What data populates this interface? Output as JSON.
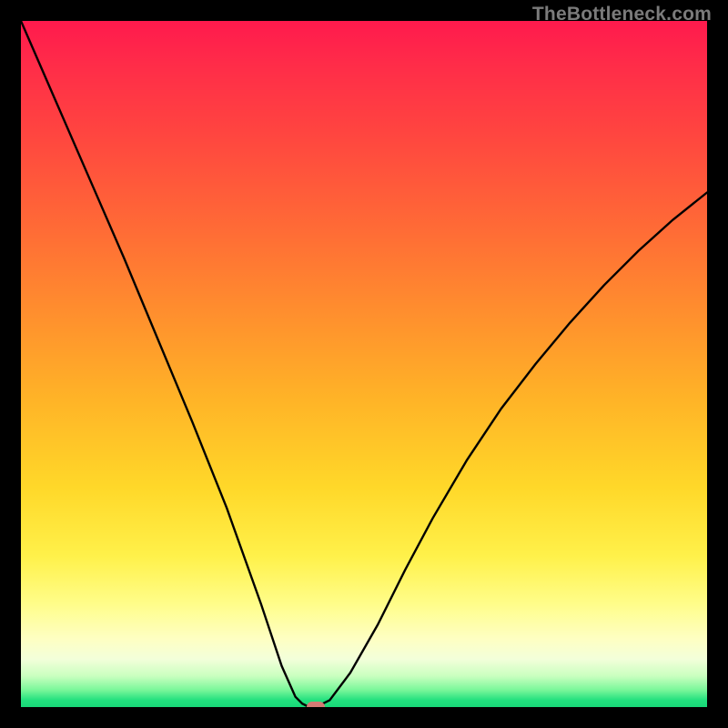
{
  "watermark": "TheBottleneck.com",
  "chart_data": {
    "type": "line",
    "title": "",
    "xlabel": "",
    "ylabel": "",
    "xlim": [
      0,
      100
    ],
    "ylim": [
      0,
      100
    ],
    "grid": false,
    "legend": false,
    "series": [
      {
        "name": "bottleneck-curve-left",
        "x": [
          0,
          5,
          10,
          15,
          20,
          25,
          30,
          35,
          38,
          40,
          41,
          42,
          43
        ],
        "y": [
          100,
          88.5,
          77,
          65.5,
          53.5,
          41.5,
          29,
          15,
          6,
          1.5,
          0.5,
          0,
          0
        ]
      },
      {
        "name": "bottleneck-curve-right",
        "x": [
          43,
          45,
          48,
          52,
          56,
          60,
          65,
          70,
          75,
          80,
          85,
          90,
          95,
          100
        ],
        "y": [
          0,
          1,
          5,
          12,
          20,
          27.5,
          36,
          43.5,
          50,
          56,
          61.5,
          66.5,
          71,
          75
        ]
      }
    ],
    "marker": {
      "x": 43,
      "y": 0,
      "color": "#d47a74"
    },
    "background_gradient": {
      "stops": [
        {
          "pos": 0,
          "color": "#ff1a4d"
        },
        {
          "pos": 0.3,
          "color": "#ff6a36"
        },
        {
          "pos": 0.55,
          "color": "#ffb327"
        },
        {
          "pos": 0.78,
          "color": "#fff14a"
        },
        {
          "pos": 0.9,
          "color": "#feffc2"
        },
        {
          "pos": 0.97,
          "color": "#7af79a"
        },
        {
          "pos": 1.0,
          "color": "#18d878"
        }
      ]
    }
  }
}
